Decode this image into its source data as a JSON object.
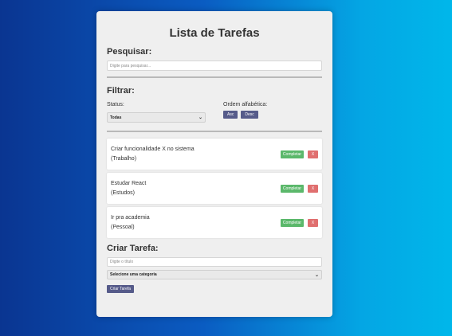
{
  "app": {
    "title": "Lista de Tarefas"
  },
  "search": {
    "title": "Pesquisar:",
    "placeholder": "Digite para pesquisar..."
  },
  "filter": {
    "title": "Filtrar:",
    "status_label": "Status:",
    "status_value": "Todas",
    "order_label": "Ordem alfabética:",
    "asc_label": "Asc",
    "desc_label": "Desc"
  },
  "todos": [
    {
      "text": "Criar funcionalidade X no sistema",
      "category": "(Trabalho)",
      "complete_label": "Completar",
      "remove_label": "X"
    },
    {
      "text": "Estudar React",
      "category": "(Estudos)",
      "complete_label": "Completar",
      "remove_label": "X"
    },
    {
      "text": "Ir pra academia",
      "category": "(Pessoal)",
      "complete_label": "Completar",
      "remove_label": "X"
    }
  ],
  "create": {
    "title": "Criar Tarefa:",
    "title_placeholder": "Digite o título",
    "category_value": "Selecione uma categoria",
    "submit_label": "Criar Tarefa"
  },
  "colors": {
    "primary_button": "#565b8a",
    "complete_button": "#5bb86b",
    "remove_button": "#e06f6f",
    "panel_bg": "#efefef"
  }
}
